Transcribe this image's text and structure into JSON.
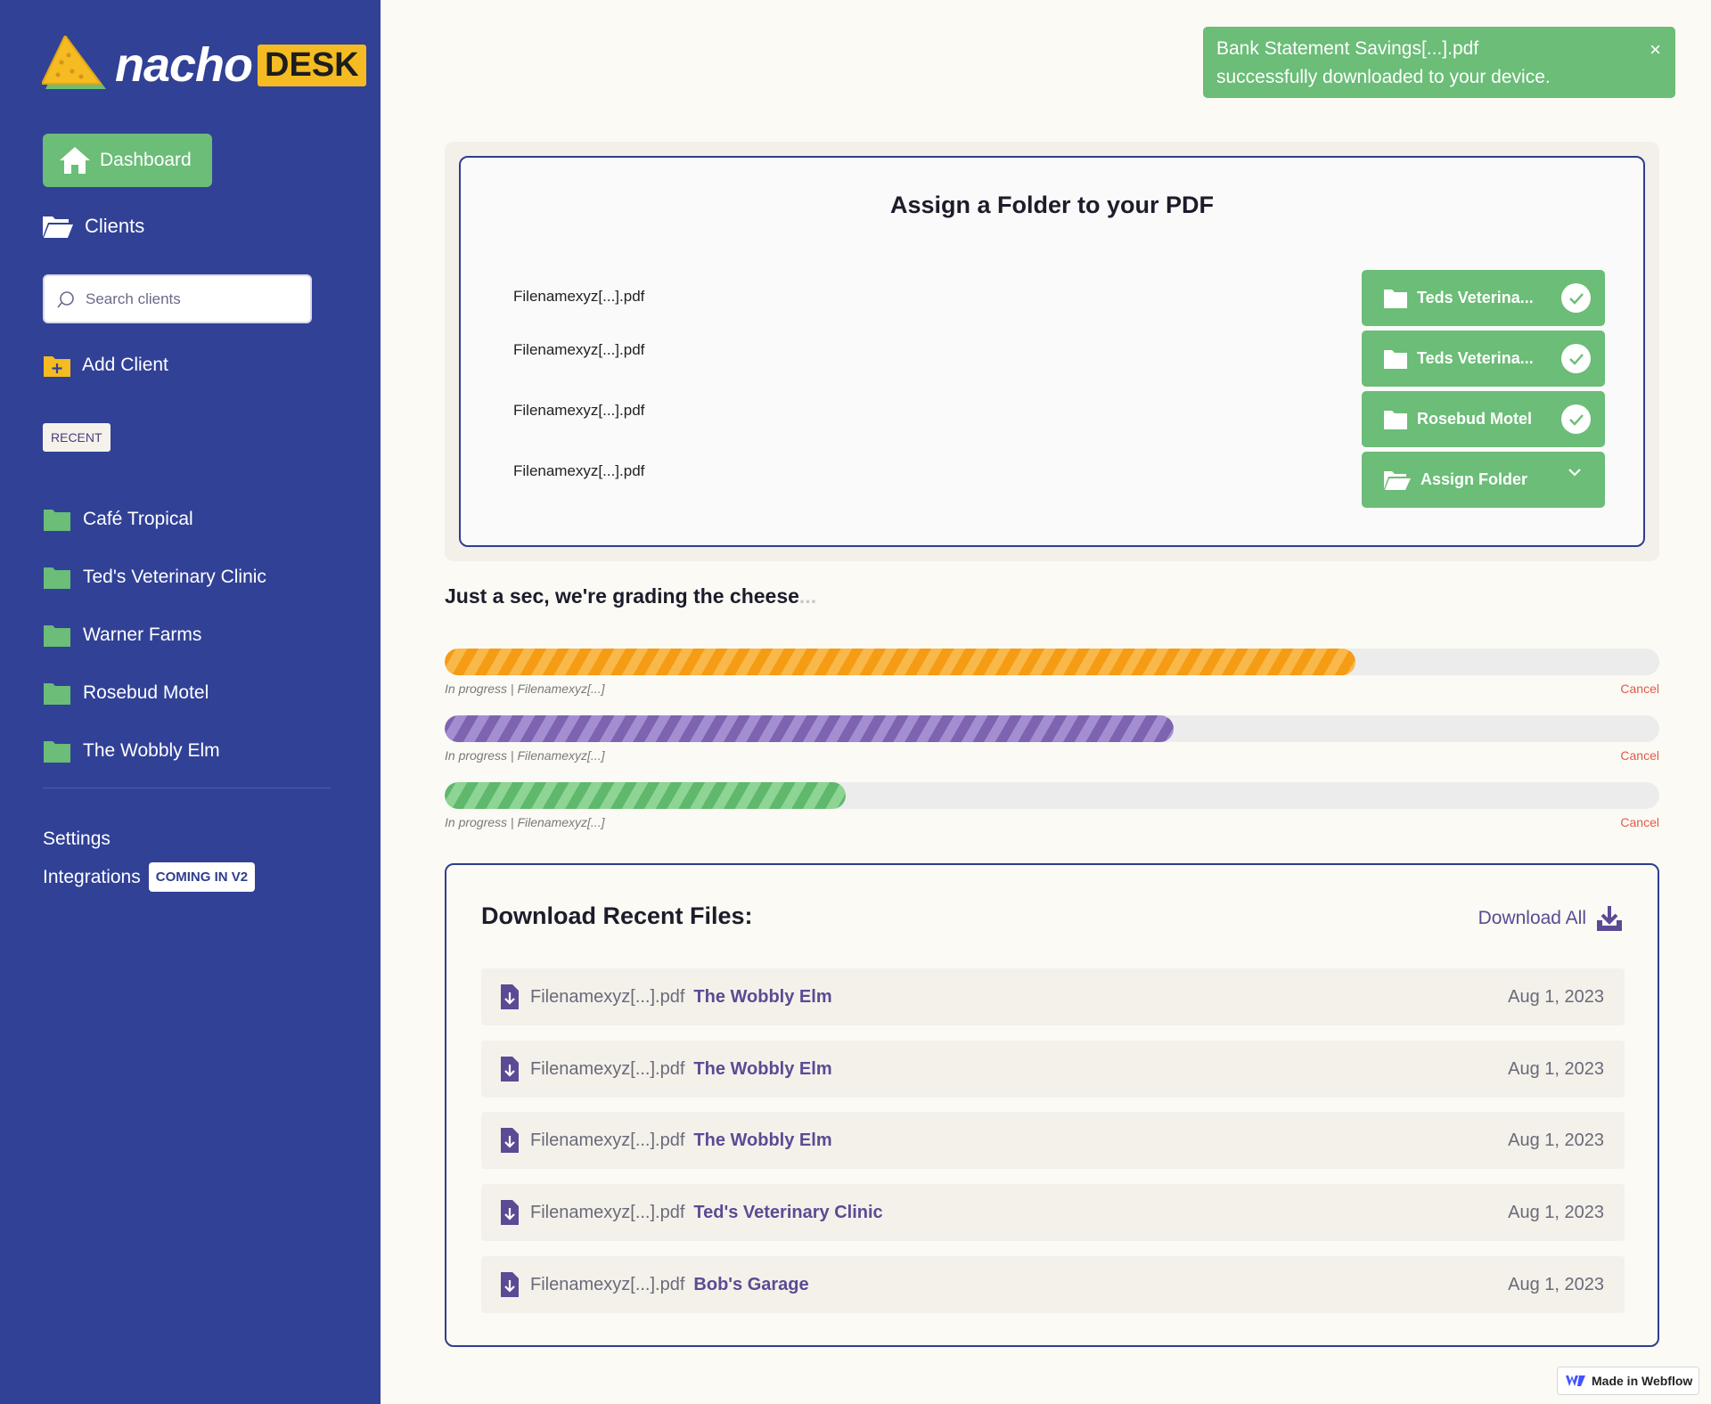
{
  "brand": {
    "word": "nacho",
    "highlight": "DESK",
    "accent": "#f4bb22",
    "sidebar_color": "#314196",
    "green": "#6bbd77"
  },
  "nav": {
    "dashboard": "Dashboard",
    "clients": "Clients",
    "search_placeholder": "Search clients",
    "add_client": "Add Client",
    "recent_label": "RECENT",
    "recent": [
      "Café Tropical",
      "Ted's Veterinary Clinic",
      "Warner Farms",
      "Rosebud Motel",
      "The Wobbly Elm"
    ],
    "settings": "Settings",
    "integrations": "Integrations",
    "coming_badge": "COMING IN V2"
  },
  "toast": {
    "line1": "Bank Statement Savings[...].pdf",
    "line2": "successfully downloaded to your device.",
    "close": "×"
  },
  "assign": {
    "title": "Assign a Folder to your PDF",
    "rows": [
      {
        "file": "Filenamexyz[...].pdf",
        "folder": "Teds Veterina...",
        "state": "assigned"
      },
      {
        "file": "Filenamexyz[...].pdf",
        "folder": "Teds Veterina...",
        "state": "assigned"
      },
      {
        "file": "Filenamexyz[...].pdf",
        "folder": "Rosebud Motel",
        "state": "assigned"
      },
      {
        "file": "Filenamexyz[...].pdf",
        "folder": "Assign Folder",
        "state": "unassigned"
      }
    ]
  },
  "progress": {
    "title": "Just a sec, we're grading the cheese",
    "dots": "...",
    "items": [
      {
        "status": "In progress | Filenamexyz[...]",
        "cancel": "Cancel",
        "fraction": 0.75,
        "color": "orange"
      },
      {
        "status": "In progress | Filenamexyz[...]",
        "cancel": "Cancel",
        "fraction": 0.6,
        "color": "purple"
      },
      {
        "status": "In progress | Filenamexyz[...]",
        "cancel": "Cancel",
        "fraction": 0.33,
        "color": "green"
      }
    ]
  },
  "downloads": {
    "title": "Download Recent Files:",
    "download_all": "Download All",
    "rows": [
      {
        "file": "Filenamexyz[...].pdf",
        "client": "The Wobbly Elm",
        "date": "Aug 1, 2023"
      },
      {
        "file": "Filenamexyz[...].pdf",
        "client": "The Wobbly Elm",
        "date": "Aug 1, 2023"
      },
      {
        "file": "Filenamexyz[...].pdf",
        "client": "The Wobbly Elm",
        "date": "Aug 1, 2023"
      },
      {
        "file": "Filenamexyz[...].pdf",
        "client": "Ted's Veterinary Clinic",
        "date": "Aug 1, 2023"
      },
      {
        "file": "Filenamexyz[...].pdf",
        "client": "Bob's Garage",
        "date": "Aug 1, 2023"
      }
    ]
  },
  "footer": {
    "webflow": "Made in Webflow"
  }
}
